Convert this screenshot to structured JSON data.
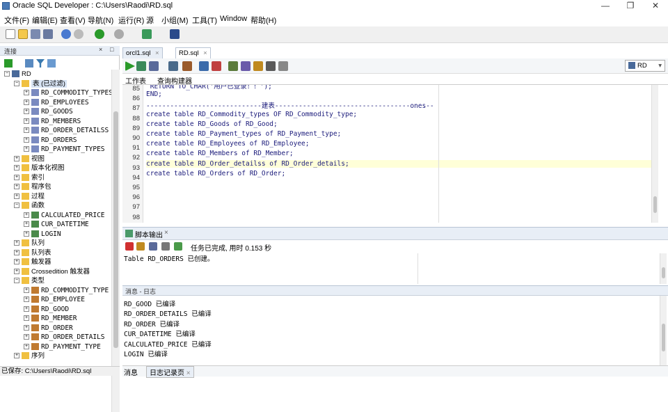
{
  "window": {
    "title": "Oracle SQL Developer : C:\\Users\\Raodi\\RD.sql",
    "btn_min": "—",
    "btn_max": "❐",
    "btn_close": "✕"
  },
  "menu": [
    "文件(F)",
    "编辑(E)",
    "查看(V)",
    "导航(N)",
    "运行(R)",
    "源",
    "小组(M)",
    "工具(T)",
    "Window",
    "帮助(H)"
  ],
  "connections_panel": {
    "title": "连接",
    "close": "×",
    "minimize": "□"
  },
  "tree": [
    {
      "label": "RD",
      "depth": 0,
      "expander": "−",
      "icon": "database-icon"
    },
    {
      "label": "表 (已过滤)",
      "depth": 1,
      "expander": "−",
      "icon": "folder-icon",
      "hl": true
    },
    {
      "label": "RD_COMMODITY_TYPES",
      "depth": 2,
      "expander": "+",
      "icon": "table-icon",
      "mono": true
    },
    {
      "label": "RD_EMPLOYEES",
      "depth": 2,
      "expander": "+",
      "icon": "table-icon",
      "mono": true
    },
    {
      "label": "RD_GOODS",
      "depth": 2,
      "expander": "+",
      "icon": "table-icon",
      "mono": true
    },
    {
      "label": "RD_MEMBERS",
      "depth": 2,
      "expander": "+",
      "icon": "table-icon",
      "mono": true
    },
    {
      "label": "RD_ORDER_DETAILSS",
      "depth": 2,
      "expander": "+",
      "icon": "table-icon",
      "mono": true
    },
    {
      "label": "RD_ORDERS",
      "depth": 2,
      "expander": "+",
      "icon": "table-icon",
      "mono": true
    },
    {
      "label": "RD_PAYMENT_TYPES",
      "depth": 2,
      "expander": "+",
      "icon": "table-icon",
      "mono": true
    },
    {
      "label": "视图",
      "depth": 1,
      "expander": "+",
      "icon": "folder-icon"
    },
    {
      "label": "版本化视图",
      "depth": 1,
      "expander": "+",
      "icon": "folder-icon"
    },
    {
      "label": "索引",
      "depth": 1,
      "expander": "+",
      "icon": "folder-icon"
    },
    {
      "label": "程序包",
      "depth": 1,
      "expander": "+",
      "icon": "folder-icon"
    },
    {
      "label": "过程",
      "depth": 1,
      "expander": "+",
      "icon": "folder-icon"
    },
    {
      "label": "函数",
      "depth": 1,
      "expander": "−",
      "icon": "folder-icon"
    },
    {
      "label": "CALCULATED_PRICE",
      "depth": 2,
      "expander": "+",
      "icon": "function-icon",
      "mono": true
    },
    {
      "label": "CUR_DATETIME",
      "depth": 2,
      "expander": "+",
      "icon": "function-icon",
      "mono": true
    },
    {
      "label": "LOGIN",
      "depth": 2,
      "expander": "+",
      "icon": "function-icon",
      "mono": true
    },
    {
      "label": "队列",
      "depth": 1,
      "expander": "+",
      "icon": "folder-icon"
    },
    {
      "label": "队列表",
      "depth": 1,
      "expander": "+",
      "icon": "folder-icon"
    },
    {
      "label": "触发器",
      "depth": 1,
      "expander": "+",
      "icon": "folder-icon"
    },
    {
      "label": "Crossedition 触发器",
      "depth": 1,
      "expander": "+",
      "icon": "folder-icon"
    },
    {
      "label": "类型",
      "depth": 1,
      "expander": "−",
      "icon": "folder-icon"
    },
    {
      "label": "RD_COMMODITY_TYPE",
      "depth": 2,
      "expander": "+",
      "icon": "type-icon",
      "mono": true
    },
    {
      "label": "RD_EMPLOYEE",
      "depth": 2,
      "expander": "+",
      "icon": "type-icon",
      "mono": true
    },
    {
      "label": "RD_GOOD",
      "depth": 2,
      "expander": "+",
      "icon": "type-icon",
      "mono": true
    },
    {
      "label": "RD_MEMBER",
      "depth": 2,
      "expander": "+",
      "icon": "type-icon",
      "mono": true
    },
    {
      "label": "RD_ORDER",
      "depth": 2,
      "expander": "+",
      "icon": "type-icon",
      "mono": true
    },
    {
      "label": "RD_ORDER_DETAILS",
      "depth": 2,
      "expander": "+",
      "icon": "type-icon",
      "mono": true
    },
    {
      "label": "RD_PAYMENT_TYPE",
      "depth": 2,
      "expander": "+",
      "icon": "type-icon",
      "mono": true
    },
    {
      "label": "序列",
      "depth": 1,
      "expander": "+",
      "icon": "folder-icon"
    }
  ],
  "statusbar": {
    "text": "已保存: C:\\Users\\Raodi\\RD.sql"
  },
  "editor": {
    "tabs": [
      {
        "label": "orcl1.sql",
        "close": "×"
      },
      {
        "label": "RD.sql",
        "close": "×"
      }
    ],
    "subtabs": [
      "工作表",
      "查询构建器"
    ],
    "connection": "RD",
    "lines": [
      {
        "n": "85",
        "text": " RETURN TO_CHAR('用户已登录！！');"
      },
      {
        "n": "86",
        "text": "END;"
      },
      {
        "n": "87",
        "text": "-----------------------------建表----------------------------------ones--"
      },
      {
        "n": "88",
        "text": "create table RD_Commodity_types OF RD_Commodity_type;"
      },
      {
        "n": "89",
        "text": "create table RD_Goods of RD_Good;"
      },
      {
        "n": "90",
        "text": "create table RD_Payment_types of RD_Payment_type;"
      },
      {
        "n": "91",
        "text": "create table RD_Employees of RD_Employee;"
      },
      {
        "n": "92",
        "text": "create table RD_Members of RD_Member;"
      },
      {
        "n": "93",
        "text": "create table RD_Order_detailss of RD_Order_details;"
      },
      {
        "n": "94",
        "text": "create table RD_Orders of RD_Order;"
      },
      {
        "n": "95",
        "text": ""
      },
      {
        "n": "96",
        "text": ""
      },
      {
        "n": "97",
        "text": ""
      },
      {
        "n": "98",
        "text": ""
      }
    ]
  },
  "script_output": {
    "tab": "脚本输出",
    "close": "×",
    "status": "任务已完成, 用时 0.153 秒",
    "text": "Table RD_ORDERS 已创建。"
  },
  "messages": {
    "title": "消息 - 日志",
    "lines": [
      "RD_GOOD 已编译",
      "RD_ORDER_DETAILS 已编译",
      "RD_ORDER 已编译",
      "CUR_DATETIME 已编译",
      "CALCULATED_PRICE 已编译",
      "LOGIN 已编译"
    ],
    "tabs": [
      "消息",
      "日志记录页"
    ],
    "tab_close": "×"
  }
}
